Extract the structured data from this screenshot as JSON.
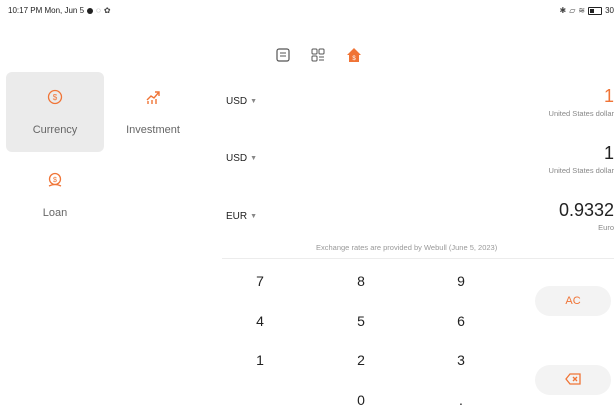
{
  "status_bar": {
    "time": "10:17 PM Mon, Jun 5",
    "right_icons": [
      "bluetooth-icon",
      "no-sim-icon",
      "wifi-icon",
      "battery-icon"
    ],
    "battery_text": "30"
  },
  "toolbar": {
    "icons": [
      "list-icon",
      "grid-icon",
      "home-icon"
    ],
    "active_color": "#f07436"
  },
  "sidebar": {
    "items": [
      {
        "label": "Currency",
        "icon": "dollar-circle-icon",
        "active": true
      },
      {
        "label": "Investment",
        "icon": "chart-up-icon",
        "active": false
      },
      {
        "label": "Loan",
        "icon": "loan-icon",
        "active": false
      }
    ]
  },
  "rows": [
    {
      "code": "USD",
      "value": "1",
      "name": "United States dollar",
      "active": true
    },
    {
      "code": "USD",
      "value": "1",
      "name": "United States dollar",
      "active": false
    },
    {
      "code": "EUR",
      "value": "0.9332",
      "name": "Euro",
      "active": false
    }
  ],
  "note": "Exchange rates are provided by Webull (June 5, 2023)",
  "keypad": {
    "digits": [
      "7",
      "8",
      "9",
      "4",
      "5",
      "6",
      "1",
      "2",
      "3",
      "0",
      "."
    ],
    "ac_label": "AC"
  },
  "colors": {
    "accent": "#f07436",
    "muted": "#888888",
    "surface": "#ebebeb"
  }
}
